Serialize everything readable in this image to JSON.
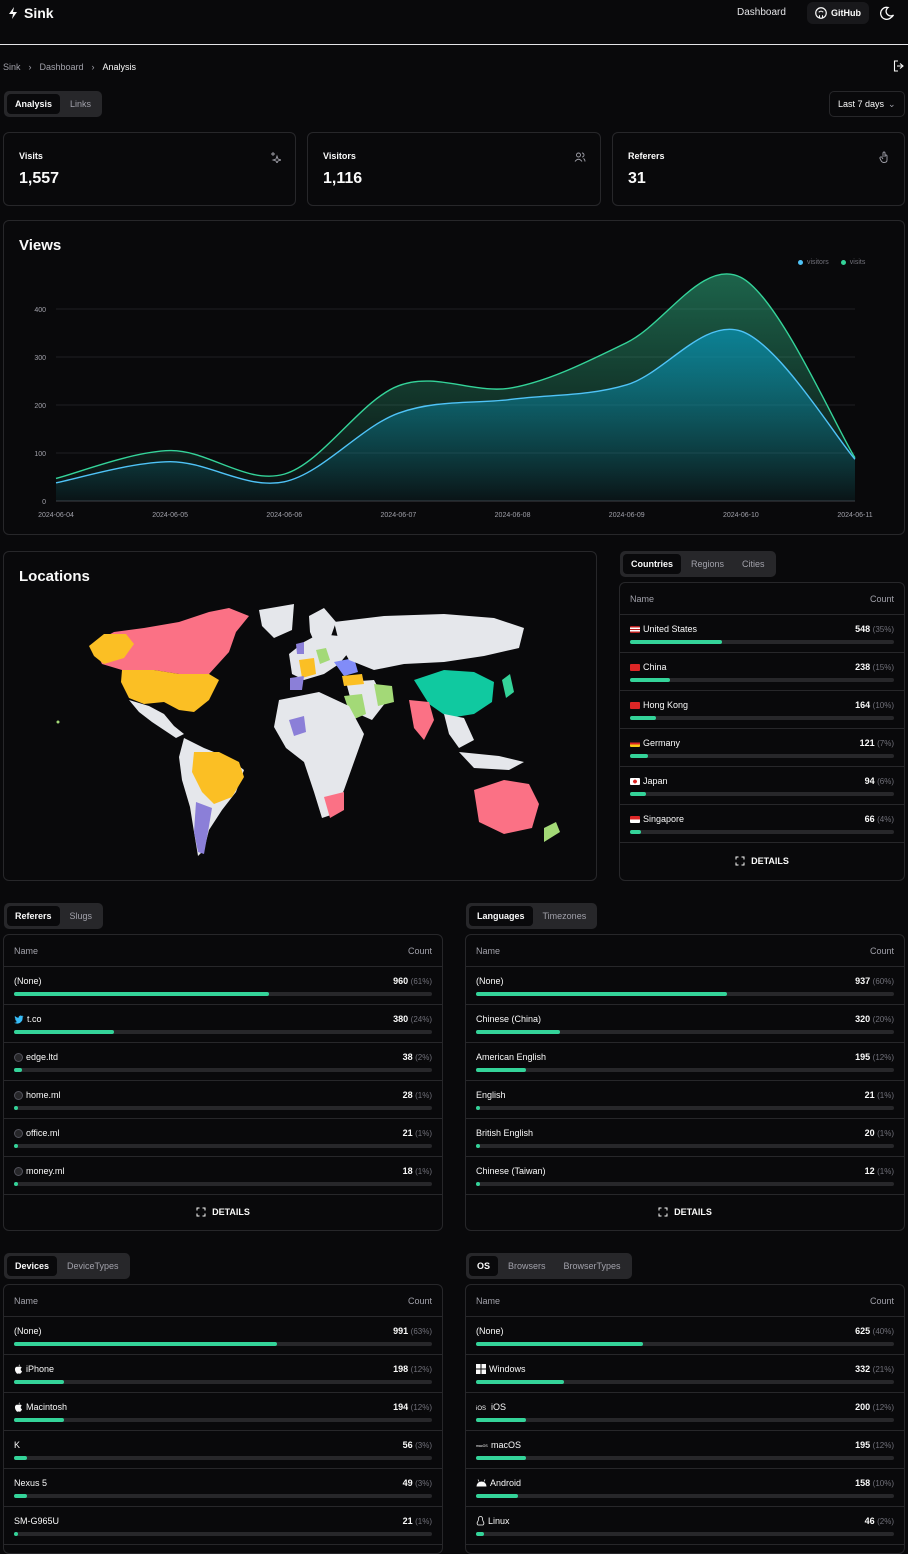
{
  "header": {
    "app_name": "Sink",
    "nav_dashboard": "Dashboard",
    "github_label": "GitHub"
  },
  "breadcrumb": {
    "items": [
      "Sink",
      "Dashboard",
      "Analysis"
    ]
  },
  "main_tabs": [
    "Analysis",
    "Links"
  ],
  "range_select": {
    "value": "Last 7 days"
  },
  "stats": [
    {
      "title": "Visits",
      "value": "1,557",
      "icon": "sparkles-icon"
    },
    {
      "title": "Visitors",
      "value": "1,116",
      "icon": "users-icon"
    },
    {
      "title": "Referers",
      "value": "31",
      "icon": "pointer-icon"
    }
  ],
  "views": {
    "title": "Views",
    "legend": [
      "visitors",
      "visits"
    ]
  },
  "chart_data": {
    "type": "area",
    "x": [
      "2024-06-04",
      "2024-06-05",
      "2024-06-06",
      "2024-06-07",
      "2024-06-08",
      "2024-06-09",
      "2024-06-10",
      "2024-06-11"
    ],
    "yticks": [
      "0",
      "100",
      "200",
      "300",
      "400"
    ],
    "ylim": [
      0,
      450
    ],
    "grid": true,
    "legend_position": "top-right",
    "series": [
      {
        "name": "visitors",
        "color": "#4fc3f7",
        "values": [
          38,
          82,
          40,
          183,
          212,
          242,
          354,
          87
        ]
      },
      {
        "name": "visits",
        "color": "#34d399",
        "values": [
          47,
          105,
          56,
          240,
          236,
          330,
          466,
          90
        ]
      }
    ]
  },
  "locations": {
    "title": "Locations",
    "tabs": [
      "Countries",
      "Regions",
      "Cities"
    ],
    "col_name": "Name",
    "col_count": "Count",
    "rows": [
      {
        "name": "United States",
        "count": "548",
        "pct": "(35%)",
        "fraction": 0.35,
        "flag": "us"
      },
      {
        "name": "China",
        "count": "238",
        "pct": "(15%)",
        "fraction": 0.15,
        "flag": "cn"
      },
      {
        "name": "Hong Kong",
        "count": "164",
        "pct": "(10%)",
        "fraction": 0.1,
        "flag": "hk"
      },
      {
        "name": "Germany",
        "count": "121",
        "pct": "(7%)",
        "fraction": 0.07,
        "flag": "de"
      },
      {
        "name": "Japan",
        "count": "94",
        "pct": "(6%)",
        "fraction": 0.06,
        "flag": "jp"
      },
      {
        "name": "Singapore",
        "count": "66",
        "pct": "(4%)",
        "fraction": 0.04,
        "flag": "sg"
      }
    ],
    "details_label": "DETAILS"
  },
  "referers": {
    "tabs": [
      "Referers",
      "Slugs"
    ],
    "col_name": "Name",
    "col_count": "Count",
    "rows": [
      {
        "name": "(None)",
        "count": "960",
        "pct": "(61%)",
        "fraction": 0.61,
        "icon": ""
      },
      {
        "name": "t.co",
        "count": "380",
        "pct": "(24%)",
        "fraction": 0.24,
        "icon": "twitter-icon"
      },
      {
        "name": "edge.ltd",
        "count": "38",
        "pct": "(2%)",
        "fraction": 0.02,
        "icon": "favicon-icon"
      },
      {
        "name": "home.ml",
        "count": "28",
        "pct": "(1%)",
        "fraction": 0.01,
        "icon": "favicon-icon"
      },
      {
        "name": "office.ml",
        "count": "21",
        "pct": "(1%)",
        "fraction": 0.01,
        "icon": "favicon-icon"
      },
      {
        "name": "money.ml",
        "count": "18",
        "pct": "(1%)",
        "fraction": 0.01,
        "icon": "favicon-icon"
      }
    ],
    "details_label": "DETAILS"
  },
  "languages": {
    "tabs": [
      "Languages",
      "Timezones"
    ],
    "col_name": "Name",
    "col_count": "Count",
    "rows": [
      {
        "name": "(None)",
        "count": "937",
        "pct": "(60%)",
        "fraction": 0.6
      },
      {
        "name": "Chinese (China)",
        "count": "320",
        "pct": "(20%)",
        "fraction": 0.2
      },
      {
        "name": "American English",
        "count": "195",
        "pct": "(12%)",
        "fraction": 0.12
      },
      {
        "name": "English",
        "count": "21",
        "pct": "(1%)",
        "fraction": 0.01
      },
      {
        "name": "British English",
        "count": "20",
        "pct": "(1%)",
        "fraction": 0.01
      },
      {
        "name": "Chinese (Taiwan)",
        "count": "12",
        "pct": "(1%)",
        "fraction": 0.01
      }
    ],
    "details_label": "DETAILS"
  },
  "devices": {
    "tabs": [
      "Devices",
      "DeviceTypes"
    ],
    "col_name": "Name",
    "col_count": "Count",
    "rows": [
      {
        "name": "(None)",
        "count": "991",
        "pct": "(63%)",
        "fraction": 0.63,
        "icon": ""
      },
      {
        "name": "iPhone",
        "count": "198",
        "pct": "(12%)",
        "fraction": 0.12,
        "icon": "apple-icon"
      },
      {
        "name": "Macintosh",
        "count": "194",
        "pct": "(12%)",
        "fraction": 0.12,
        "icon": "apple-icon"
      },
      {
        "name": "K",
        "count": "56",
        "pct": "(3%)",
        "fraction": 0.03,
        "icon": ""
      },
      {
        "name": "Nexus 5",
        "count": "49",
        "pct": "(3%)",
        "fraction": 0.03,
        "icon": ""
      },
      {
        "name": "SM-G965U",
        "count": "21",
        "pct": "(1%)",
        "fraction": 0.01,
        "icon": ""
      }
    ]
  },
  "os": {
    "tabs": [
      "OS",
      "Browsers",
      "BrowserTypes"
    ],
    "col_name": "Name",
    "col_count": "Count",
    "rows": [
      {
        "name": "(None)",
        "count": "625",
        "pct": "(40%)",
        "fraction": 0.4,
        "icon": ""
      },
      {
        "name": "Windows",
        "count": "332",
        "pct": "(21%)",
        "fraction": 0.21,
        "icon": "windows-icon"
      },
      {
        "name": "iOS",
        "count": "200",
        "pct": "(12%)",
        "fraction": 0.12,
        "icon": "ios-icon"
      },
      {
        "name": "macOS",
        "count": "195",
        "pct": "(12%)",
        "fraction": 0.12,
        "icon": "macos-icon"
      },
      {
        "name": "Android",
        "count": "158",
        "pct": "(10%)",
        "fraction": 0.1,
        "icon": "android-icon"
      },
      {
        "name": "Linux",
        "count": "46",
        "pct": "(2%)",
        "fraction": 0.02,
        "icon": "linux-icon"
      }
    ]
  },
  "colors": {
    "accent": "#34d399",
    "visitors": "#4fc3f7",
    "border": "#27272a",
    "muted": "#a1a1aa"
  }
}
